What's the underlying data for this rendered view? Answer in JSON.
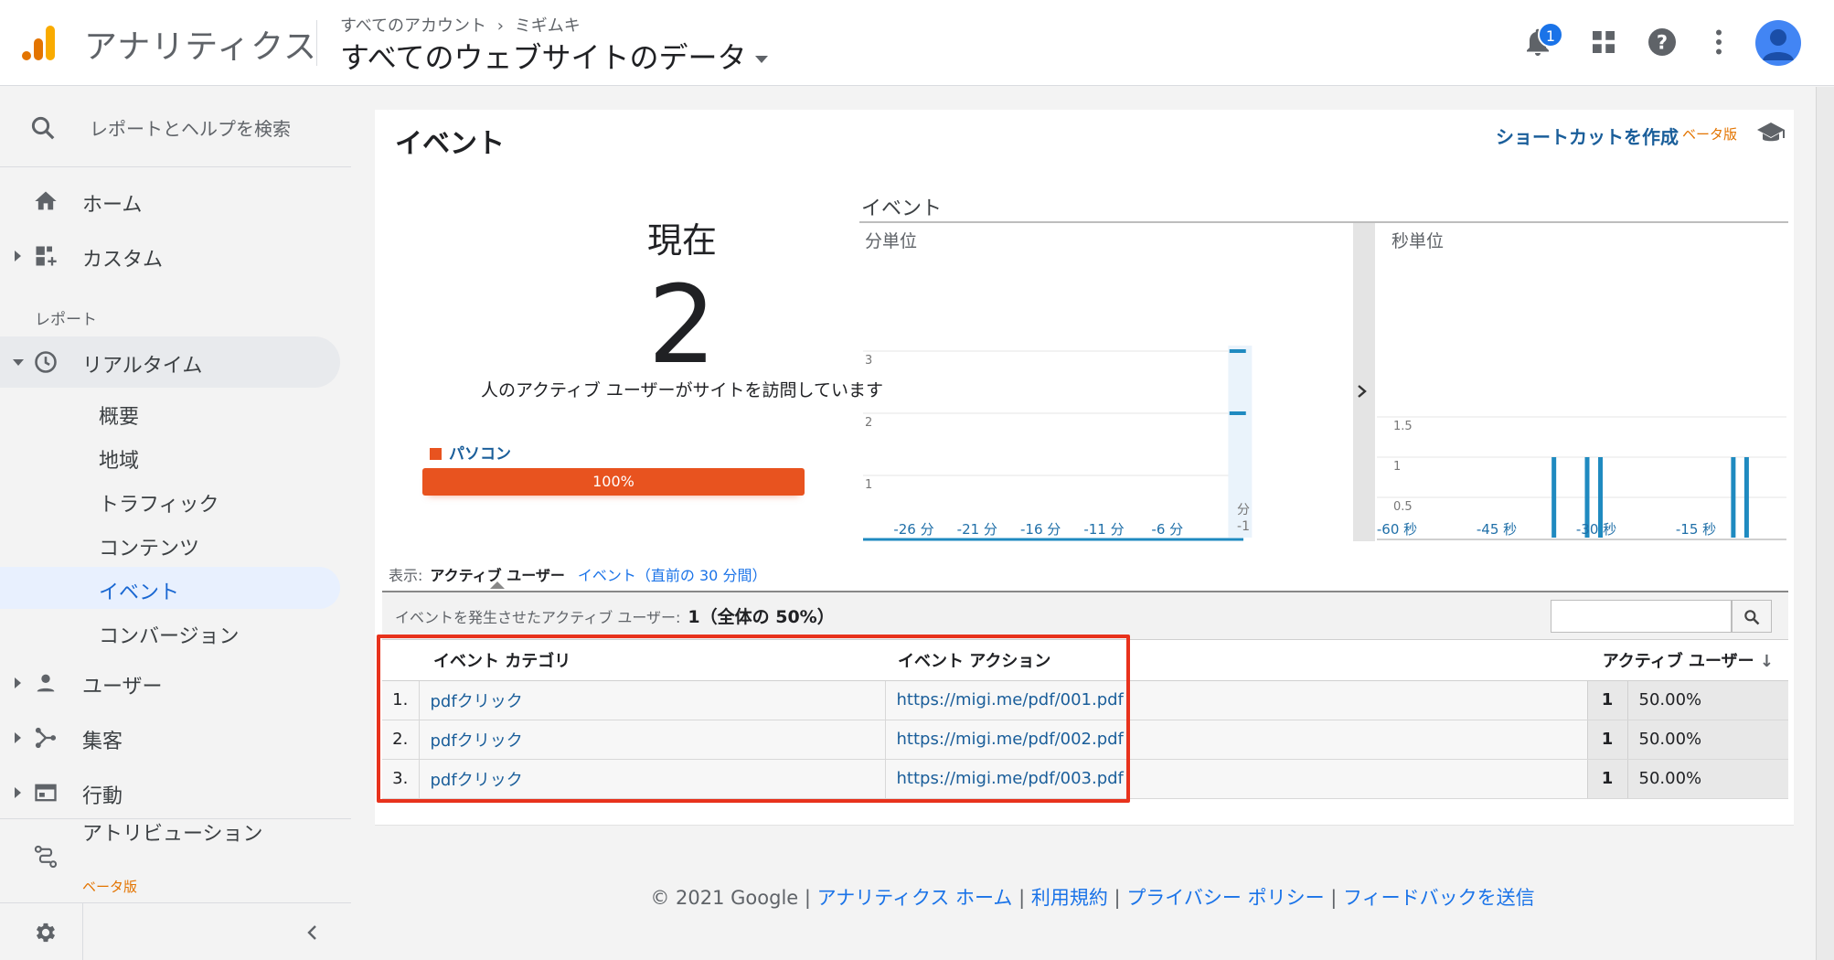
{
  "header": {
    "app_name": "アナリティクス",
    "breadcrumb_account": "すべてのアカウント",
    "breadcrumb_property": "ミギムキ",
    "property_view": "すべてのウェブサイトのデータ",
    "notification_count": "1"
  },
  "sidebar": {
    "search_label": "レポートとヘルプを検索",
    "home": "ホーム",
    "custom": "カスタム",
    "section_reports": "レポート",
    "realtime": "リアルタイム",
    "realtime_items": [
      "概要",
      "地域",
      "トラフィック",
      "コンテンツ",
      "イベント",
      "コンバージョン"
    ],
    "users": "ユーザー",
    "acquisition": "集客",
    "behavior": "行動",
    "attribution": "アトリビューション",
    "attribution_beta": "ベータ版"
  },
  "page": {
    "title": "イベント",
    "shortcut": "ショートカットを作成",
    "beta": "ベータ版",
    "now_label": "現在",
    "now_count": "2",
    "now_desc": "人のアクティブ ユーザーがサイトを訪問しています",
    "device_label": "パソコン",
    "device_percent": "100%"
  },
  "chart_data": {
    "type": "bar",
    "title": "イベント",
    "panels": [
      {
        "name": "分単位",
        "y_ticks": [
          "1",
          "2",
          "3"
        ],
        "x_ticks": [
          "-26 分",
          "-21 分",
          "-16 分",
          "-11 分",
          "-6 分"
        ],
        "x_end_label": [
          "分",
          "-1"
        ],
        "bars": [
          {
            "x": -1,
            "values": [
              3,
              2
            ]
          }
        ]
      },
      {
        "name": "秒単位",
        "y_ticks": [
          "0.5",
          "1",
          "1.5"
        ],
        "x_ticks": [
          "-60 秒",
          "-45 秒",
          "-30 秒",
          "-15 秒"
        ],
        "bars": [
          {
            "x": -35,
            "value": 1
          },
          {
            "x": -30,
            "value": 1
          },
          {
            "x": -28,
            "value": 1
          },
          {
            "x": -8,
            "value": 1
          },
          {
            "x": -6,
            "value": 1
          }
        ]
      }
    ]
  },
  "table": {
    "show_label": "表示:",
    "show_active": "アクティブ ユーザー",
    "show_events": "イベント（直前の 30 分間）",
    "summary_label": "イベントを発生させたアクティブ ユーザー:",
    "summary_value": "1（全体の 50%）",
    "col_category": "イベント カテゴリ",
    "col_action": "イベント アクション",
    "col_users": "アクティブ ユーザー",
    "rows": [
      {
        "idx": "1.",
        "category": "pdfクリック",
        "action": "https://migi.me/pdf/001.pdf",
        "users": "1",
        "pct": "50.00%"
      },
      {
        "idx": "2.",
        "category": "pdfクリック",
        "action": "https://migi.me/pdf/002.pdf",
        "users": "1",
        "pct": "50.00%"
      },
      {
        "idx": "3.",
        "category": "pdfクリック",
        "action": "https://migi.me/pdf/003.pdf",
        "users": "1",
        "pct": "50.00%"
      }
    ]
  },
  "footer": {
    "copyright": "© 2021 Google",
    "links": [
      "アナリティクス ホーム",
      "利用規約",
      "プライバシー ポリシー",
      "フィードバックを送信"
    ]
  },
  "colors": {
    "accent_blue": "#1a73e8",
    "link_blue": "#1a5e9a",
    "bar_blue": "#1f8ac0",
    "device_orange": "#e8531f",
    "highlight_red": "#e8321c",
    "beta_orange": "#e37400"
  }
}
